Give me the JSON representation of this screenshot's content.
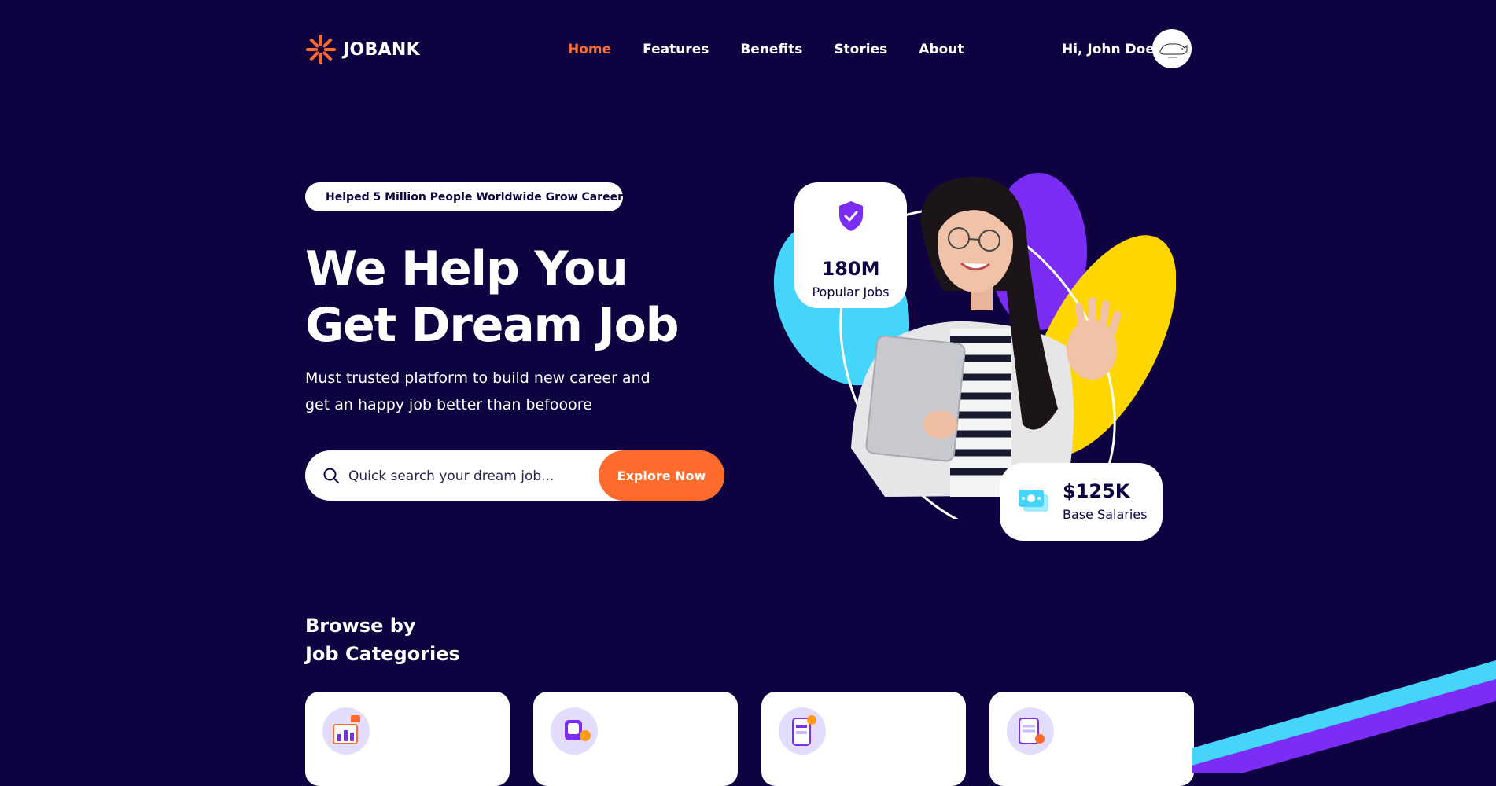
{
  "brand": {
    "name": "JOBANK"
  },
  "nav": {
    "items": [
      {
        "label": "Home",
        "active": true
      },
      {
        "label": "Features",
        "active": false
      },
      {
        "label": "Benefits",
        "active": false
      },
      {
        "label": "Stories",
        "active": false
      },
      {
        "label": "About",
        "active": false
      }
    ]
  },
  "user": {
    "greeting": "Hi, John Doe"
  },
  "hero": {
    "badge": "Helped 5 Million People Worldwide Grow Career",
    "title_line1": "We Help You",
    "title_line2": "Get Dream Job",
    "subtitle": "Must trusted platform to build new career and get an happy job better than befooore",
    "search_placeholder": "Quick search your dream job...",
    "search_value": "",
    "cta": "Explore Now"
  },
  "stats": {
    "jobs": {
      "value": "180M",
      "label": "Popular Jobs",
      "icon": "shield-check-icon"
    },
    "salary": {
      "value": "$125K",
      "label": "Base Salaries",
      "icon": "money-icon"
    }
  },
  "categories": {
    "title_line1": "Browse by",
    "title_line2": "Job Categories",
    "icons": [
      "chart-growth-icon",
      "watch-coin-icon",
      "mobile-dev-icon",
      "search-doc-icon"
    ]
  },
  "colors": {
    "background": "#0f0240",
    "accent": "#ff6b2c",
    "purple": "#7b2cf5",
    "cyan": "#45d4fa",
    "yellow": "#ffd600",
    "white": "#ffffff"
  }
}
